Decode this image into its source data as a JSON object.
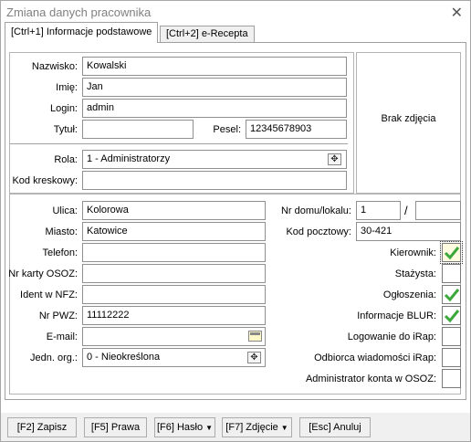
{
  "window": {
    "title": "Zmiana danych pracownika",
    "close_icon": "close-icon"
  },
  "tabs": [
    {
      "label": "[Ctrl+1] Informacje podstawowe",
      "active": true
    },
    {
      "label": "[Ctrl+2] e-Recepta",
      "active": false
    }
  ],
  "personal": {
    "nazwisko_label": "Nazwisko:",
    "nazwisko_value": "Kowalski",
    "imie_label": "Imię:",
    "imie_value": "Jan",
    "login_label": "Login:",
    "login_value": "admin",
    "tytul_label": "Tytuł:",
    "tytul_value": "",
    "pesel_label": "Pesel:",
    "pesel_value": "12345678903",
    "rola_label": "Rola:",
    "rola_value": "1 - Administratorzy",
    "kod_label": "Kod kreskowy:",
    "kod_value": ""
  },
  "photo": {
    "label": "Brak zdjęcia"
  },
  "address": {
    "ulica_label": "Ulica:",
    "ulica_value": "Kolorowa",
    "nr_domu_label": "Nr domu/lokalu:",
    "nr_domu_value": "1",
    "slash": "/",
    "nr_lokalu_value": "",
    "miasto_label": "Miasto:",
    "miasto_value": "Katowice",
    "kod_pocztowy_label": "Kod pocztowy:",
    "kod_pocztowy_value": "30-421",
    "telefon_label": "Telefon:",
    "telefon_value": "",
    "osoz_label": "Nr karty OSOZ:",
    "osoz_value": "",
    "nfz_label": "Ident w NFZ:",
    "nfz_value": "",
    "pwz_label": "Nr PWZ:",
    "pwz_value": "11112222",
    "email_label": "E-mail:",
    "email_value": "",
    "jedn_label": "Jedn. org.:",
    "jedn_value": "0 - Nieokreślona"
  },
  "flags": [
    {
      "label": "Kierownik:",
      "checked": true
    },
    {
      "label": "Stażysta:",
      "checked": false
    },
    {
      "label": "Ogłoszenia:",
      "checked": true
    },
    {
      "label": "Informacje BLUR:",
      "checked": true
    },
    {
      "label": "Logowanie do iRap:",
      "checked": false
    },
    {
      "label": "Odbiorca wiadomości iRap:",
      "checked": false
    },
    {
      "label": "Administrator konta w OSOZ:",
      "checked": false
    }
  ],
  "buttons": {
    "save": "[F2] Zapisz",
    "rights": "[F5] Prawa",
    "password": "[F6] Hasło",
    "photo": "[F7] Zdjęcie",
    "cancel": "[Esc] Anuluj"
  },
  "colors": {
    "check": "#3aa83a",
    "accent_focus": "#fffbe0"
  }
}
